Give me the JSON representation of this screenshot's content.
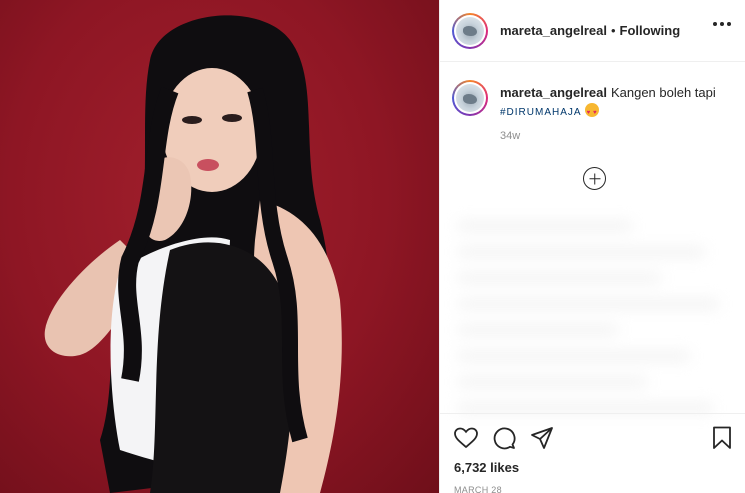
{
  "post": {
    "image_alt": "portrait photo",
    "author": {
      "username": "mareta_angelreal",
      "follow_status": "Following",
      "separator": "•"
    },
    "caption": {
      "username": "mareta_angelreal",
      "text": "Kangen boleh tapi",
      "hashtag": "#DIRUMAHAJA",
      "emoji": "star-struck-emoji",
      "time_ago": "34w"
    },
    "likes": "6,732 likes",
    "date": "MARCH 28"
  },
  "icons": {
    "more": "more-options-icon",
    "load_more": "plus-circle-icon",
    "like": "heart-icon",
    "comment": "comment-icon",
    "share": "share-icon",
    "save": "bookmark-icon"
  },
  "colors": {
    "background_red": "#8e1624",
    "hashtag": "#00376b",
    "text": "#262626",
    "muted": "#8e8e8e"
  }
}
